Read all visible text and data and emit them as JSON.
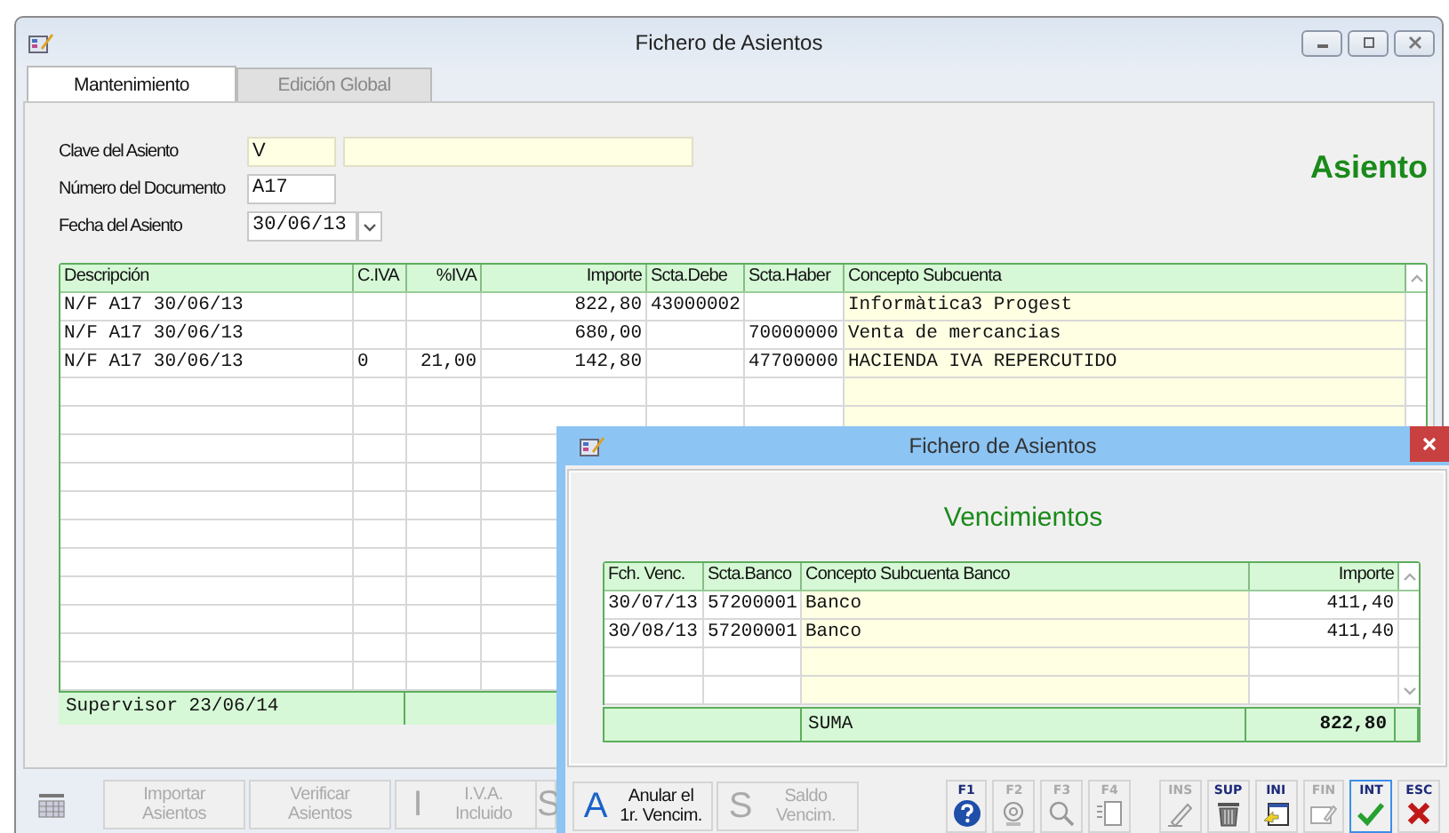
{
  "window": {
    "title": "Fichero de Asientos"
  },
  "tabs": [
    {
      "label": "Mantenimiento",
      "selected": true
    },
    {
      "label": "Edición Global",
      "selected": false
    }
  ],
  "form": [
    {
      "label": "Clave del Asiento",
      "value": "V",
      "kind": "key"
    },
    {
      "label": "Número del Documento",
      "value": "A17",
      "kind": "text"
    },
    {
      "label": "Fecha del Asiento",
      "value": "30/06/13",
      "kind": "date"
    }
  ],
  "heading": "Asiento",
  "table": {
    "columns": [
      "Descripción",
      "C.IVA",
      "%IVA",
      "Importe",
      "Scta.Debe",
      "Scta.Haber",
      "Concepto Subcuenta"
    ],
    "rows": [
      [
        "N/F A17 30/06/13",
        null,
        null,
        "822,80",
        "43000002",
        null,
        "Informàtica3 Progest"
      ],
      [
        "N/F A17 30/06/13",
        null,
        null,
        "680,00",
        null,
        "70000000",
        "Venta de mercancias"
      ],
      [
        "N/F A17 30/06/13",
        "0",
        "21,00",
        "142,80",
        null,
        "47700000",
        "HACIENDA IVA REPERCUTIDO"
      ]
    ],
    "footer": "Supervisor 23/06/14"
  },
  "toolbar": [
    {
      "kind": "tool"
    },
    {
      "kind": "text",
      "lines": [
        "Importar",
        "Asientos"
      ],
      "disabled": true
    },
    {
      "kind": "text",
      "lines": [
        "Verificar",
        "Asientos"
      ],
      "disabled": true
    },
    {
      "kind": "letter",
      "letter": "I",
      "lines": [
        "I.V.A.",
        "Incluido"
      ],
      "disabled": true
    },
    {
      "kind": "letter",
      "letter": "S",
      "disabled": true
    }
  ],
  "dialog": {
    "title": "Fichero de Asientos",
    "heading": "Vencimientos",
    "columns": [
      "Fch. Venc.",
      "Scta.Banco",
      "Concepto Subcuenta Banco",
      "Importe"
    ],
    "rows": [
      [
        "30/07/13",
        "57200001",
        "Banco",
        "411,40"
      ],
      [
        "30/08/13",
        "57200001",
        "Banco",
        "411,40"
      ]
    ],
    "total_label": "SUMA",
    "total": "822,80",
    "buttons": [
      {
        "letter": "A",
        "lines": [
          "Anular el",
          "1r. Vencim."
        ],
        "disabled": false
      },
      {
        "letter": "S",
        "lines": [
          "Saldo",
          "Vencim."
        ],
        "disabled": true
      }
    ],
    "keys": [
      {
        "key": "F1",
        "kind": "help",
        "disabled": false,
        "focused": false
      },
      {
        "key": "F2",
        "kind": "mail",
        "disabled": true,
        "focused": false
      },
      {
        "key": "F3",
        "kind": "search",
        "disabled": true,
        "focused": false
      },
      {
        "key": "F4",
        "kind": "list",
        "disabled": true,
        "focused": false
      },
      {
        "key": "INS",
        "kind": "pen",
        "disabled": true,
        "focused": false
      },
      {
        "key": "SUP",
        "kind": "trash",
        "disabled": false,
        "focused": false
      },
      {
        "key": "INI",
        "kind": "first",
        "disabled": false,
        "focused": false
      },
      {
        "key": "FIN",
        "kind": "last",
        "disabled": true,
        "focused": false
      },
      {
        "key": "INT",
        "kind": "ok",
        "disabled": false,
        "focused": true
      },
      {
        "key": "ESC",
        "kind": "cancel",
        "disabled": false,
        "focused": false
      }
    ]
  }
}
